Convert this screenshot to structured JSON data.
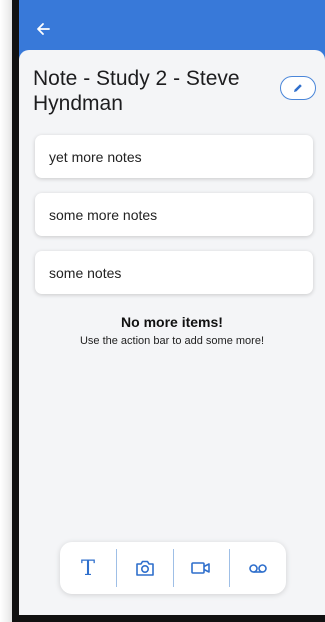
{
  "header": {
    "back_icon": "arrow-left-icon",
    "title": "Note - Study 2 - Steve Hyndman",
    "edit_icon": "pencil-icon"
  },
  "notes": [
    {
      "label": "yet more notes"
    },
    {
      "label": "some more notes"
    },
    {
      "label": "some notes"
    }
  ],
  "empty_state": {
    "title": "No more items!",
    "subtitle": "Use the action bar to add some more!"
  },
  "action_bar": {
    "items": [
      {
        "icon": "text-icon",
        "glyph": "T"
      },
      {
        "icon": "camera-icon"
      },
      {
        "icon": "video-icon"
      },
      {
        "icon": "voicemail-icon"
      }
    ]
  },
  "colors": {
    "topbar": "#3879d9",
    "accent": "#4a86d9",
    "panel": "#f4f5f7"
  }
}
